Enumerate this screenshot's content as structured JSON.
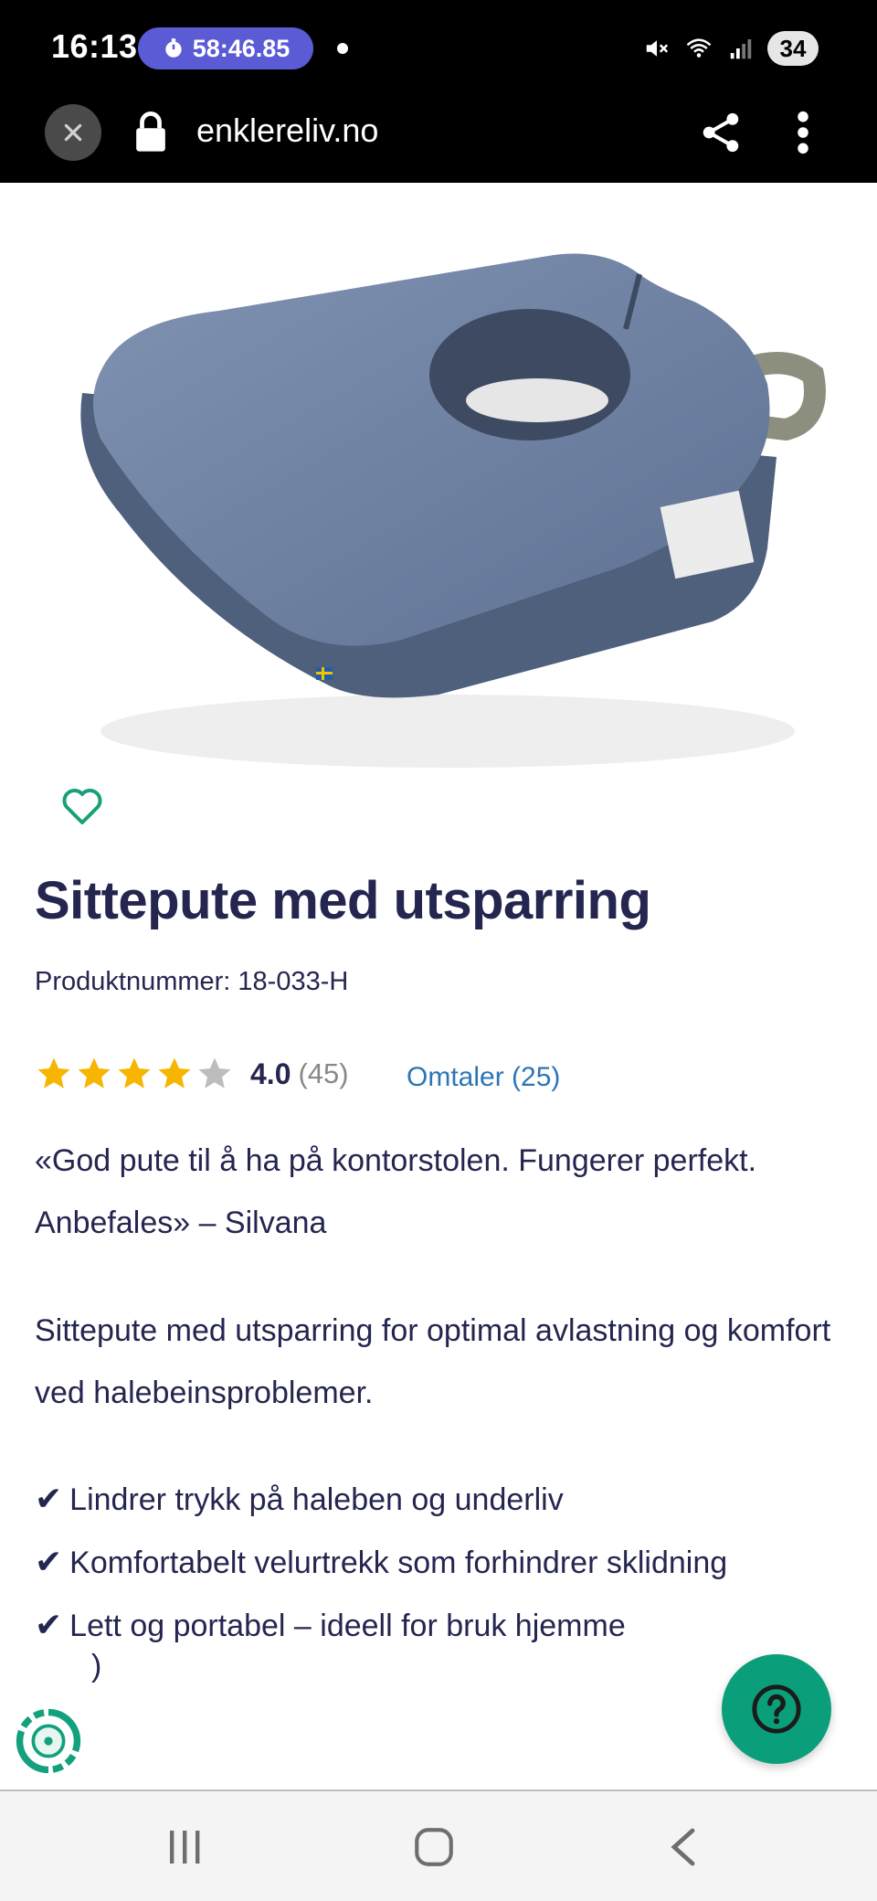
{
  "status_bar": {
    "time": "16:13",
    "timer": "58:46.85",
    "battery": "34"
  },
  "browser": {
    "url": "enklereliv.no"
  },
  "product": {
    "title": "Sittepute med utsparring",
    "product_number": "Produktnummer: 18-033-H",
    "rating": "4.0",
    "rating_value": 4.0,
    "rating_max": 5,
    "rating_count": "(45)",
    "reviews_link": "Omtaler (25)",
    "quote": "«God pute til å ha på kontorstolen. Fungerer perfekt. Anbefales» – Silvana",
    "description": "Sittepute med utsparring for optimal avlastning og komfort ved halebeinsproblemer.",
    "features": [
      {
        "check": "✔",
        "text": "Lindrer trykk på haleben og underliv"
      },
      {
        "check": "✔",
        "text": "Komfortabelt velurtrekk som forhindrer sklidning"
      },
      {
        "check": "✔",
        "text": "Lett og portabel – ideell for bruk hjemme"
      }
    ],
    "feature_partial": ")"
  },
  "colors": {
    "title": "#242650",
    "star": "#f7b500",
    "star_empty": "#bdbdbd",
    "link": "#2d76b6",
    "help_button": "#0a9f7a",
    "timer_pill": "#5b5bd6"
  },
  "icons": {
    "favorite": "heart-outline-icon",
    "help": "question-mark-icon",
    "eco": "recycle-badge-icon"
  }
}
